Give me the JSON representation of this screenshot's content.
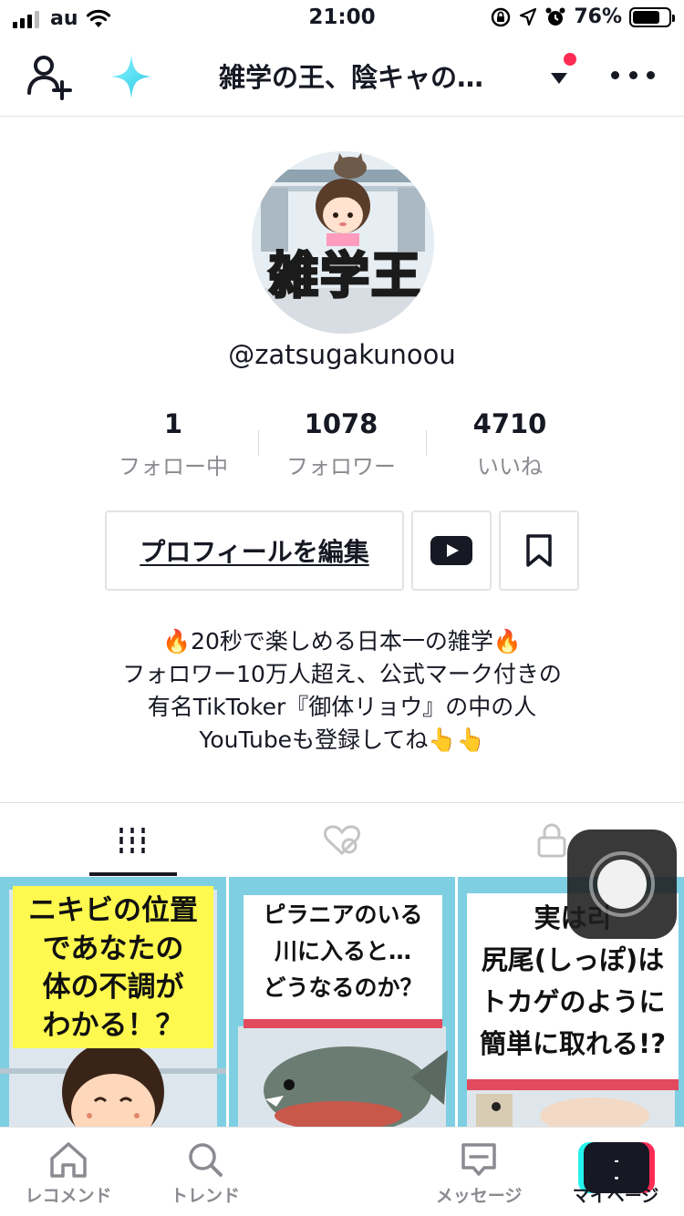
{
  "status_bar": {
    "carrier": "au",
    "time": "21:00",
    "battery_percent": "76%",
    "battery_level": 0.76
  },
  "header": {
    "title": "雑学の王、陰キャの…",
    "notification_dot_color": "#fe2c55"
  },
  "profile": {
    "avatar_text": "雑学王",
    "username": "@zatsugakunoou",
    "stats": [
      {
        "value": "1",
        "label": "フォロー中"
      },
      {
        "value": "1078",
        "label": "フォロワー"
      },
      {
        "value": "4710",
        "label": "いいね"
      }
    ],
    "edit_button": "プロフィールを編集",
    "bio": [
      "🔥20秒で楽しめる日本一の雑学🔥",
      "フォロワー10万人超え、公式マーク付きの",
      "有名TikToker『御体リョウ』の中の人",
      "YouTubeも登録してね👆👆"
    ]
  },
  "videos": [
    {
      "caption": "ニキビの位置\nであなたの\n体の不調が\nわかる！？"
    },
    {
      "caption": "ピラニアのいる\n川に入ると…\nどうなるのか？"
    },
    {
      "caption": "実は리\n尻尾(しっぽ)は\nトカゲのように\n簡単に取れる!?"
    }
  ],
  "bottom_nav": [
    {
      "label": "レコメンド",
      "icon": "home-icon"
    },
    {
      "label": "トレンド",
      "icon": "search-icon"
    },
    {
      "label": "",
      "icon": "plus-icon"
    },
    {
      "label": "メッセージ",
      "icon": "message-icon"
    },
    {
      "label": "マイページ",
      "icon": "profile-icon"
    }
  ],
  "colors": {
    "accent_red": "#fe2c55",
    "accent_cyan": "#25f4ee",
    "text": "#161823",
    "muted": "#8a8b91"
  }
}
